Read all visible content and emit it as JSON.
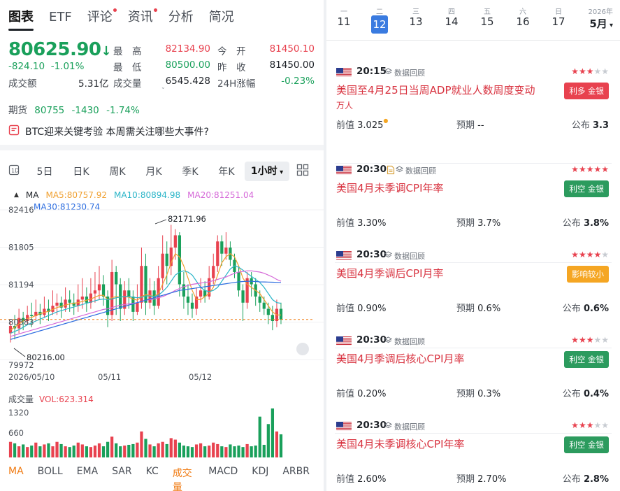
{
  "tabs": [
    {
      "label": "图表",
      "active": true,
      "dot": false
    },
    {
      "label": "ETF",
      "active": false,
      "dot": false
    },
    {
      "label": "评论",
      "active": false,
      "dot": true
    },
    {
      "label": "资讯",
      "active": false,
      "dot": true
    },
    {
      "label": "分析",
      "active": false,
      "dot": false
    },
    {
      "label": "简况",
      "active": false,
      "dot": false
    }
  ],
  "quote": {
    "price": "80625.90",
    "change": "-824.10",
    "change_pct": "-1.01%",
    "turnover_label": "成交额",
    "turnover": "5.31亿",
    "high_label": "最　高",
    "high": "82134.90",
    "low_label": "最　低",
    "low": "80500.00",
    "volume_label": "成交量",
    "volume": "6545.428",
    "open_label": "今　开",
    "open": "81450.10",
    "prev_label": "昨　收",
    "prev": "81450.00",
    "change24_label": "24H涨幅",
    "change24": "-0.23%"
  },
  "futures": {
    "label": "期货",
    "value": "80755",
    "change": "-1430",
    "pct": "-1.74%"
  },
  "news_line": "BTC迎来关键考验 本周需关注哪些大事件?",
  "periods": [
    "5日",
    "日K",
    "周K",
    "月K",
    "季K",
    "年K",
    "1小时"
  ],
  "selected_period": "1小时",
  "ma": {
    "label": "MA",
    "ma5": "MA5:80757.92",
    "ma10": "MA10:80894.98",
    "ma20": "MA20:81251.04",
    "ma30": "MA30:81230.74",
    "colors": {
      "ma5": "#f0a030",
      "ma10": "#2bb5c8",
      "ma20": "#d568d8",
      "ma30": "#2f6fe0"
    }
  },
  "chart_data": {
    "type": "candlestick",
    "y_ticks": [
      "82416",
      "81805",
      "81194",
      "80583",
      "79972"
    ],
    "x_ticks": [
      "2026/05/10",
      "05/11",
      "05/12"
    ],
    "annotations": {
      "high": "82171.96",
      "low": "80216.00"
    },
    "ylim": [
      79972,
      82416
    ],
    "candles": [
      [
        80400,
        80520,
        80250,
        80600
      ],
      [
        80520,
        80480,
        80300,
        80700
      ],
      [
        80480,
        80650,
        80400,
        80800
      ],
      [
        80650,
        80600,
        80450,
        80750
      ],
      [
        80600,
        80700,
        80550,
        80850
      ],
      [
        80700,
        80680,
        80500,
        80900
      ],
      [
        80680,
        80750,
        80600,
        80950
      ],
      [
        80750,
        80700,
        80550,
        80880
      ],
      [
        80700,
        80800,
        80650,
        81000
      ],
      [
        80800,
        80750,
        80600,
        80950
      ],
      [
        80750,
        80850,
        80700,
        81100
      ],
      [
        80850,
        80900,
        80700,
        81050
      ],
      [
        80900,
        80820,
        80650,
        81000
      ],
      [
        80820,
        80950,
        80750,
        81150
      ],
      [
        80950,
        80900,
        80750,
        81100
      ],
      [
        80900,
        80850,
        80700,
        81050
      ],
      [
        80850,
        80950,
        80750,
        81200
      ],
      [
        80950,
        81000,
        80800,
        81300
      ],
      [
        81000,
        80900,
        80750,
        81150
      ],
      [
        80900,
        81050,
        80800,
        81300
      ],
      [
        81050,
        81100,
        80900,
        81400
      ],
      [
        81100,
        81200,
        80950,
        81500
      ],
      [
        81200,
        81000,
        80850,
        81350
      ],
      [
        81000,
        80700,
        80500,
        81100
      ],
      [
        80700,
        81400,
        80600,
        81600
      ],
      [
        81400,
        81200,
        80700,
        81500
      ],
      [
        81200,
        80800,
        80600,
        81300
      ],
      [
        80800,
        81100,
        80700,
        81250
      ],
      [
        81100,
        81000,
        80800,
        81300
      ],
      [
        81000,
        80750,
        80600,
        81100
      ],
      [
        80750,
        80900,
        80700,
        81200
      ],
      [
        80900,
        81500,
        80800,
        81800
      ],
      [
        81500,
        80900,
        80700,
        81700
      ],
      [
        80900,
        81100,
        80800,
        81300
      ],
      [
        81100,
        80850,
        80700,
        81250
      ],
      [
        80850,
        81300,
        80800,
        81500
      ],
      [
        81300,
        81700,
        81100,
        82000
      ],
      [
        81700,
        81500,
        81200,
        81900
      ],
      [
        81500,
        81800,
        81350,
        82171
      ],
      [
        81800,
        82000,
        81600,
        82100
      ],
      [
        82000,
        81200,
        81000,
        82050
      ],
      [
        81200,
        81000,
        80800,
        81400
      ],
      [
        81000,
        80900,
        80700,
        81200
      ],
      [
        80900,
        80800,
        80650,
        81050
      ],
      [
        80800,
        81000,
        80700,
        81150
      ],
      [
        81000,
        81100,
        80900,
        81300
      ],
      [
        81100,
        81000,
        80900,
        81250
      ],
      [
        81000,
        81300,
        80950,
        81500
      ],
      [
        81300,
        81500,
        81200,
        81700
      ],
      [
        81500,
        81900,
        81400,
        82000
      ],
      [
        81900,
        81700,
        81500,
        82000
      ],
      [
        81700,
        81800,
        81600,
        82050
      ],
      [
        81800,
        81600,
        81500,
        81900
      ],
      [
        81600,
        81400,
        81300,
        81700
      ],
      [
        81400,
        81100,
        81000,
        81500
      ],
      [
        81100,
        80900,
        80600,
        81200
      ],
      [
        80900,
        81300,
        80800,
        81400
      ],
      [
        81300,
        81200,
        81000,
        81400
      ],
      [
        81200,
        81000,
        80850,
        81300
      ],
      [
        81000,
        80900,
        80750,
        81100
      ],
      [
        80900,
        80800,
        80700,
        81000
      ],
      [
        80800,
        80700,
        80550,
        80900
      ],
      [
        80700,
        80600,
        80450,
        80850
      ],
      [
        80600,
        80800,
        80500,
        80950
      ],
      [
        80800,
        80625,
        80550,
        80900
      ]
    ],
    "ma_lines": {
      "ma5": [
        80450,
        80500,
        80550,
        80600,
        80640,
        80660,
        80690,
        80720,
        80740,
        80760,
        80790,
        80820,
        80840,
        80860,
        80880,
        80890,
        80900,
        80920,
        80940,
        80960,
        80990,
        81020,
        81020,
        80950,
        80980,
        81000,
        80990,
        81000,
        80990,
        80960,
        80940,
        81000,
        81030,
        81020,
        81000,
        81050,
        81200,
        81350,
        81550,
        81700,
        81650,
        81500,
        81300,
        81100,
        80950,
        80950,
        81000,
        81050,
        81150,
        81350,
        81550,
        81650,
        81700,
        81650,
        81500,
        81300,
        81200,
        81150,
        81100,
        81050,
        80950,
        80850,
        80750,
        80700,
        80700
      ],
      "ma10": [
        80400,
        80430,
        80460,
        80500,
        80540,
        80570,
        80600,
        80630,
        80660,
        80690,
        80720,
        80750,
        80770,
        80790,
        80810,
        80830,
        80850,
        80870,
        80890,
        80910,
        80930,
        80950,
        80960,
        80950,
        80960,
        80980,
        80990,
        81000,
        81000,
        80990,
        80980,
        80990,
        81010,
        81010,
        81000,
        81020,
        81080,
        81150,
        81250,
        81350,
        81400,
        81420,
        81400,
        81350,
        81250,
        81150,
        81100,
        81080,
        81100,
        81150,
        81250,
        81350,
        81450,
        81500,
        81480,
        81430,
        81380,
        81330,
        81280,
        81230,
        81150,
        81050,
        80950,
        80900,
        80890
      ],
      "ma20": [
        80350,
        80370,
        80390,
        80410,
        80430,
        80450,
        80470,
        80490,
        80510,
        80530,
        80550,
        80570,
        80590,
        80610,
        80630,
        80650,
        80670,
        80690,
        80710,
        80730,
        80750,
        80770,
        80790,
        80800,
        80820,
        80840,
        80860,
        80870,
        80880,
        80890,
        80900,
        80920,
        80940,
        80950,
        80960,
        80980,
        81000,
        81030,
        81060,
        81100,
        81130,
        81160,
        81180,
        81200,
        81210,
        81220,
        81230,
        81240,
        81260,
        81280,
        81300,
        81320,
        81350,
        81380,
        81400,
        81410,
        81420,
        81420,
        81410,
        81400,
        81380,
        81350,
        81320,
        81280,
        81250
      ],
      "ma30": [
        80300,
        80320,
        80340,
        80360,
        80380,
        80400,
        80420,
        80440,
        80460,
        80480,
        80500,
        80520,
        80540,
        80560,
        80580,
        80600,
        80620,
        80640,
        80660,
        80680,
        80700,
        80720,
        80740,
        80760,
        80780,
        80800,
        80820,
        80840,
        80860,
        80880,
        80900,
        80920,
        80940,
        80960,
        80980,
        81000,
        81020,
        81040,
        81060,
        81080,
        81100,
        81110,
        81120,
        81130,
        81140,
        81150,
        81160,
        81170,
        81180,
        81190,
        81200,
        81210,
        81220,
        81230,
        81240,
        81245,
        81250,
        81250,
        81245,
        81240,
        81238,
        81236,
        81234,
        81232,
        81230
      ]
    },
    "current_line": 80625.9
  },
  "volume": {
    "label": "成交量",
    "vol_text": "VOL:623.314",
    "y_ticks": [
      "1320",
      "660"
    ],
    "ymax": 1320,
    "bars": [
      420,
      380,
      300,
      350,
      280,
      320,
      400,
      300,
      350,
      380,
      300,
      420,
      360,
      300,
      280,
      320,
      400,
      350,
      300,
      280,
      320,
      380,
      300,
      420,
      560,
      380,
      300,
      320,
      340,
      360,
      400,
      700,
      500,
      350,
      300,
      380,
      420,
      360,
      520,
      480,
      400,
      320,
      300,
      280,
      350,
      380,
      300,
      320,
      400,
      360,
      300,
      280,
      350,
      300,
      320,
      280,
      360,
      300,
      320,
      1100,
      340,
      900,
      1320,
      700,
      623
    ]
  },
  "indicators": [
    "MA",
    "BOLL",
    "EMA",
    "SAR",
    "KC",
    "成交量",
    "MACD",
    "KDJ",
    "ARBR"
  ],
  "calendar": {
    "days": [
      {
        "wd": "一",
        "dn": "11",
        "selected": false
      },
      {
        "wd": "二",
        "dn": "12",
        "selected": true
      },
      {
        "wd": "三",
        "dn": "13",
        "selected": false
      },
      {
        "wd": "四",
        "dn": "14",
        "selected": false
      },
      {
        "wd": "五",
        "dn": "15",
        "selected": false
      },
      {
        "wd": "六",
        "dn": "16",
        "selected": false
      },
      {
        "wd": "日",
        "dn": "17",
        "selected": false
      }
    ],
    "year": "2026年",
    "month": "5月"
  },
  "events": [
    {
      "time": "20:15",
      "src": "数据回顾",
      "has_doc": false,
      "stars": 3,
      "title": "美国至4月25日当周ADP就业人数周度变动",
      "title2": "万人",
      "badge": "利多 金银",
      "badge_type": "red",
      "prev_label": "前值",
      "prev": "3.025",
      "prev_dot": true,
      "forecast_label": "预期",
      "forecast": "--",
      "actual_label": "公布",
      "actual": "3.3"
    },
    {
      "time": "20:30",
      "src": "数据回顾",
      "has_doc": true,
      "stars": 5,
      "title": "美国4月未季调CPI年率",
      "title2": "",
      "badge": "利空 金银",
      "badge_type": "green",
      "prev_label": "前值",
      "prev": "3.30%",
      "prev_dot": false,
      "forecast_label": "预期",
      "forecast": "3.7%",
      "actual_label": "公布",
      "actual": "3.8%"
    },
    {
      "time": "20:30",
      "src": "数据回顾",
      "has_doc": false,
      "stars": 4,
      "title": "美国4月季调后CPI月率",
      "title2": "",
      "badge": "影响较小",
      "badge_type": "orange",
      "prev_label": "前值",
      "prev": "0.90%",
      "prev_dot": false,
      "forecast_label": "预期",
      "forecast": "0.6%",
      "actual_label": "公布",
      "actual": "0.6%"
    },
    {
      "time": "20:30",
      "src": "数据回顾",
      "has_doc": false,
      "stars": 3,
      "title": "美国4月季调后核心CPI月率",
      "title2": "",
      "badge": "利空 金银",
      "badge_type": "green",
      "prev_label": "前值",
      "prev": "0.20%",
      "prev_dot": false,
      "forecast_label": "预期",
      "forecast": "0.3%",
      "actual_label": "公布",
      "actual": "0.4%"
    },
    {
      "time": "20:30",
      "src": "数据回顾",
      "has_doc": false,
      "stars": 3,
      "title": "美国4月未季调核心CPI年率",
      "title2": "",
      "badge": "利空 金银",
      "badge_type": "green",
      "prev_label": "前值",
      "prev": "2.60%",
      "prev_dot": false,
      "forecast_label": "预期",
      "forecast": "2.70%",
      "actual_label": "公布",
      "actual": "2.8%"
    }
  ]
}
